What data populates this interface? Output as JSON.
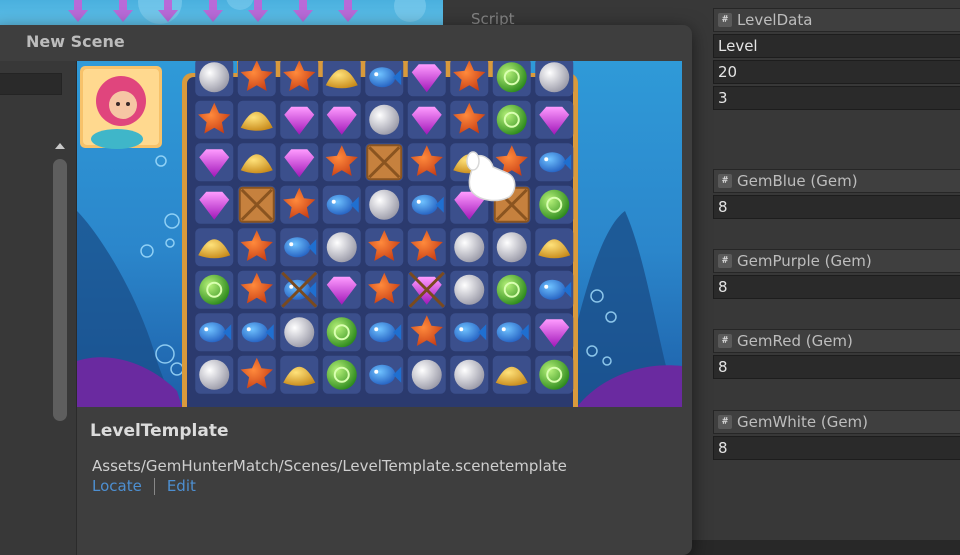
{
  "dialog": {
    "title": "New Scene",
    "template_name": "LevelTemplate",
    "template_path": "Assets/GemHunterMatch/Scenes/LevelTemplate.scenetemplate",
    "locate_label": "Locate",
    "edit_label": "Edit"
  },
  "inspector": {
    "script_label": "Script",
    "level_data_type": "LevelData",
    "fields": [
      "Level",
      "20",
      "3"
    ],
    "goals": [
      {
        "name": "GemBlue (Gem)",
        "value": "8"
      },
      {
        "name": "GemPurple (Gem)",
        "value": "8"
      },
      {
        "name": "GemRed (Gem)",
        "value": "8"
      },
      {
        "name": "GemWhite (Gem)",
        "value": "8"
      }
    ]
  },
  "preview": {
    "board_rows": [
      [
        "pearl",
        "star",
        "star",
        "shell",
        "fish",
        "gem",
        "star",
        "orb",
        "pearl"
      ],
      [
        "star",
        "shell",
        "gem",
        "gem",
        "pearl",
        "gem",
        "star",
        "orb",
        "gem"
      ],
      [
        "gem",
        "shell",
        "gem",
        "star",
        "crate",
        "star",
        "shell",
        "star",
        "fish"
      ],
      [
        "gem",
        "crate",
        "star",
        "fish",
        "pearl",
        "fish",
        "gem",
        "crate",
        "orb"
      ],
      [
        "shell",
        "star",
        "fish",
        "pearl",
        "star",
        "star",
        "pearl",
        "pearl",
        "shell"
      ],
      [
        "orb",
        "star",
        "fish",
        "gem",
        "star",
        "gem",
        "pearl",
        "orb",
        "fish"
      ],
      [
        "fish",
        "fish",
        "pearl",
        "orb",
        "fish",
        "star",
        "fish",
        "fish",
        "gem"
      ],
      [
        "pearl",
        "star",
        "shell",
        "orb",
        "fish",
        "pearl",
        "pearl",
        "shell",
        "orb"
      ]
    ],
    "crossed_cells": [
      [
        5,
        2
      ],
      [
        5,
        5
      ]
    ],
    "icons": [
      "mermaid-portrait-icon",
      "pointing-hand-icon",
      "down-arrow-icon"
    ],
    "colors": {
      "link": "#4d8fd1",
      "water_top": "#2f9ad8",
      "board_frame": "#d99a3c",
      "cell": "#3b4f8c"
    }
  }
}
